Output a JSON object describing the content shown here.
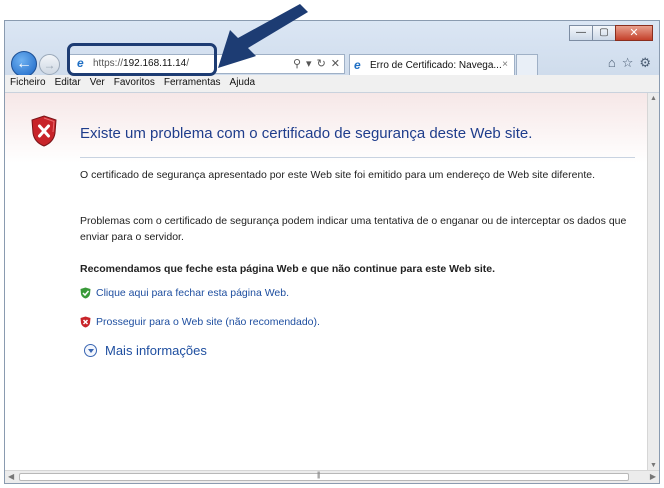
{
  "window": {
    "controls": {
      "minimize": "—",
      "maximize": "▢",
      "close": "✕"
    }
  },
  "nav": {
    "back_icon": "arrow-left-icon",
    "forward_icon": "arrow-right-icon"
  },
  "address_bar": {
    "scheme": "https://",
    "host": "192.168.11.14",
    "path": "/",
    "tools": {
      "search": "⚲",
      "dropdown": "▾",
      "refresh": "↻",
      "stop": "✕"
    }
  },
  "tab": {
    "title": "Erro de Certificado: Navega...",
    "close": "×"
  },
  "toolbar_icons": {
    "home": "⌂",
    "favorites": "☆",
    "settings": "⚙"
  },
  "menu": [
    "Ficheiro",
    "Editar",
    "Ver",
    "Favoritos",
    "Ferramentas",
    "Ajuda"
  ],
  "error_page": {
    "title": "Existe um problema com o certificado de segurança deste Web site.",
    "paragraph1": "O certificado de segurança apresentado por este Web site foi emitido para um endereço de Web site diferente.",
    "paragraph2": "Problemas com o certificado de segurança podem indicar uma tentativa de o enganar ou de interceptar os dados que enviar para o servidor.",
    "recommendation": "Recomendamos que feche esta página Web e que não continue para este Web site.",
    "link_close": "Clique aqui para fechar esta página Web.",
    "link_continue": "Prosseguir para o Web site (não recomendado).",
    "more_info": "Mais informações"
  },
  "colors": {
    "title_blue": "#1f3d8c",
    "link_blue": "#1f4fa0",
    "annotation_arrow": "#1d3c73"
  }
}
